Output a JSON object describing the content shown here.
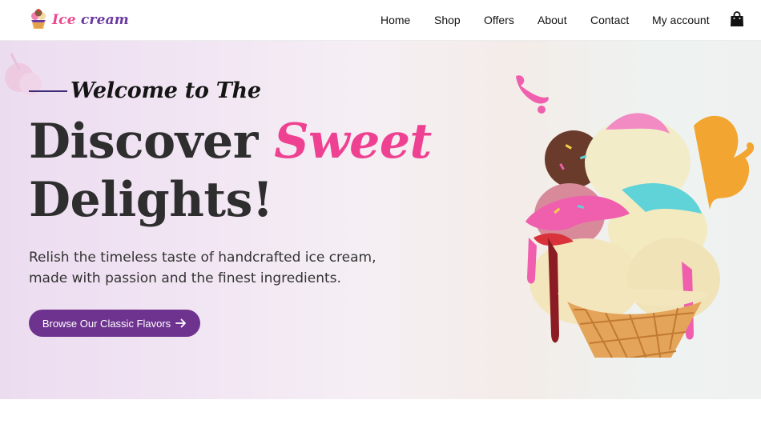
{
  "brand": {
    "name_part1": "Ice",
    "name_part2": "cream"
  },
  "nav": {
    "items": [
      {
        "label": "Home"
      },
      {
        "label": "Shop"
      },
      {
        "label": "Offers"
      },
      {
        "label": "About"
      },
      {
        "label": "Contact"
      },
      {
        "label": "My account"
      }
    ],
    "cart_icon": "shopping-bag-icon"
  },
  "hero": {
    "eyebrow": "Welcome to The",
    "headline_part1": "Discover",
    "headline_accent": "Sweet",
    "headline_part2": "Delights!",
    "description": "Relish the timeless taste of handcrafted ice cream, made with passion and the finest ingredients.",
    "cta_label": "Browse Our Classic Flavors",
    "cta_icon": "arrow-right-icon"
  },
  "colors": {
    "accent_pink": "#ef4191",
    "brand_purple": "#6d338f",
    "headline_dark": "#2e2e2e"
  }
}
